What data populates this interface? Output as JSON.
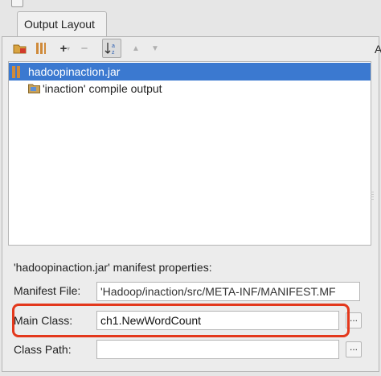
{
  "tab": {
    "label": "Output Layout"
  },
  "toolbar": {
    "buttons": [
      {
        "icon": "create-directory-icon"
      },
      {
        "icon": "archive-icon"
      },
      {
        "icon": "add-icon",
        "label": "+"
      },
      {
        "icon": "remove-icon",
        "label": "−"
      },
      {
        "icon": "sort-alpha-icon"
      },
      {
        "icon": "move-up-icon",
        "label": "▲"
      },
      {
        "icon": "move-down-icon",
        "label": "▼"
      }
    ],
    "right_label": "A"
  },
  "tree": {
    "root_label": "hadoopinaction.jar",
    "child_label": "'inaction' compile output"
  },
  "manifest": {
    "heading": "'hadoopinaction.jar' manifest properties:",
    "manifest_file_label": "Manifest File:",
    "manifest_file_value": "'Hadoop/inaction/src/META-INF/MANIFEST.MF",
    "main_class_label": "Main Class:",
    "main_class_value": "ch1.NewWordCount",
    "class_path_label": "Class Path:",
    "class_path_value": "",
    "browse_label": "..."
  },
  "colors": {
    "selection": "#3b79d0",
    "highlight": "#e3381c"
  }
}
